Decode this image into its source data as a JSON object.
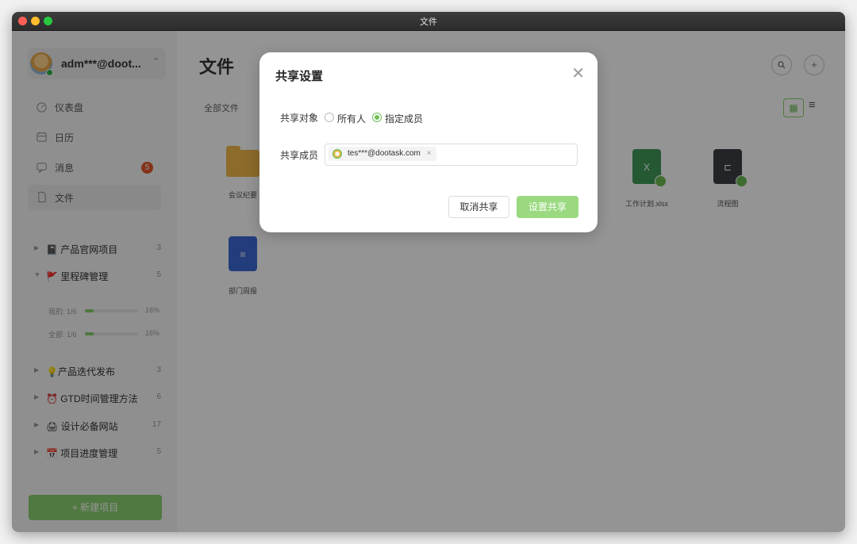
{
  "window": {
    "title": "文件"
  },
  "account": {
    "name": "adm***@doot..."
  },
  "nav": [
    {
      "label": "仪表盘"
    },
    {
      "label": "日历"
    },
    {
      "label": "消息",
      "badge": "5"
    },
    {
      "label": "文件"
    }
  ],
  "projects": [
    {
      "icon": "📓",
      "name": "产品官网项目",
      "count": "3",
      "expanded": false
    },
    {
      "icon": "🚩",
      "name": "里程碑管理",
      "count": "5",
      "expanded": true
    },
    {
      "icon": "💡",
      "name": "产品迭代发布",
      "count": "3",
      "expanded": false
    },
    {
      "icon": "⏰",
      "name": "GTD时间管理方法",
      "count": "6",
      "expanded": false
    },
    {
      "icon": "🖨",
      "name": "设计必备网站",
      "count": "17",
      "expanded": false
    },
    {
      "icon": "📅",
      "name": "项目进度管理",
      "count": "5",
      "expanded": false
    }
  ],
  "progress": [
    {
      "label": "我的: 1/6",
      "pct": "16%",
      "value": 0.16
    },
    {
      "label": "全部: 1/6",
      "pct": "16%",
      "value": 0.16
    }
  ],
  "new_project": "+  新建项目",
  "main": {
    "title": "文件",
    "breadcrumb": "全部文件",
    "search_icon": "search-icon",
    "add_icon": "plus-icon",
    "view_grid_icon": "grid-icon",
    "view_list_icon": "list-icon",
    "files": [
      {
        "name": "会议纪要",
        "type": "folder"
      },
      {
        "name": "工作计划.xlsx",
        "type": "xlsx",
        "shared": true
      },
      {
        "name": "流程图",
        "type": "flow",
        "shared": true
      },
      {
        "name": "部门周报",
        "type": "word"
      }
    ]
  },
  "modal": {
    "title": "共享设置",
    "target_label": "共享对象",
    "option_everyone": "所有人",
    "option_specific": "指定成员",
    "selected": "指定成员",
    "member_label": "共享成员",
    "member_tag": "tes***@dootask.com",
    "cancel": "取消共享",
    "confirm": "设置共享"
  },
  "colors": {
    "accent": "#8bcf70",
    "badge": "#e4562c",
    "folder": "#f2b94a",
    "excel": "#3e9a5b",
    "word": "#3d6ad6"
  }
}
